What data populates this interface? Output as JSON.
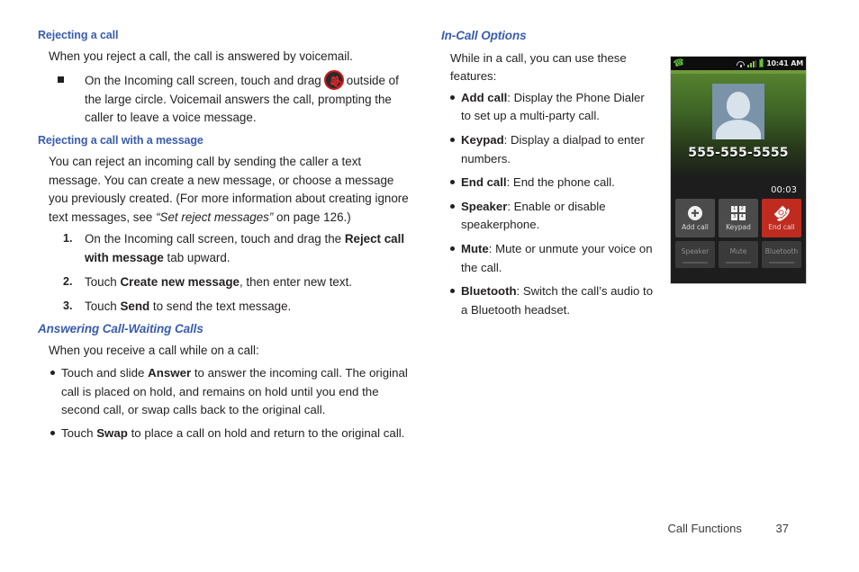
{
  "left_column": {
    "section1": {
      "heading": "Rejecting a call",
      "intro": "When you reject a call, the call is answered by voicemail.",
      "bullet_pre": "On the Incoming call screen, touch and drag",
      "bullet_post": "outside of the large circle. Voicemail answers the call, prompting the caller to leave a voice message.",
      "icon_name": "reject-call-icon"
    },
    "section2": {
      "heading": "Rejecting a call with a message",
      "intro_a": "You can reject an incoming call by sending the caller a text message. You can create a new message, or choose a message you previously created. (For more information about creating ignore text messages, see ",
      "intro_italic": "“Set reject messages”",
      "intro_b": " on page 126.)",
      "steps": [
        {
          "pre": "On the Incoming call screen, touch and drag the ",
          "bold": "Reject call with message",
          "post": " tab upward."
        },
        {
          "pre": "Touch ",
          "bold": "Create new message",
          "post": ", then enter new text."
        },
        {
          "pre": "Touch ",
          "bold": "Send",
          "post": " to send the text message."
        }
      ]
    },
    "section3": {
      "heading": "Answering Call-Waiting Calls",
      "intro": "When you receive a call while on a call:",
      "bullets": [
        {
          "pre": "Touch and slide ",
          "bold": "Answer",
          "post": " to answer the incoming call. The original call is placed on hold, and remains on hold until you end the second call, or swap calls back to the original call."
        },
        {
          "pre": "Touch ",
          "bold": "Swap",
          "post": " to place a call on hold and return to the original call."
        }
      ]
    }
  },
  "right_column": {
    "heading": "In-Call Options",
    "intro": "While in a call, you can use these features:",
    "options": [
      {
        "term": "Add call",
        "desc": ": Display the Phone Dialer to set up a multi-party call."
      },
      {
        "term": "Keypad",
        "desc": ": Display a dialpad to enter numbers."
      },
      {
        "term": "End call",
        "desc": ": End the phone call."
      },
      {
        "term": "Speaker",
        "desc": ": Enable or disable speakerphone."
      },
      {
        "term": "Mute",
        "desc": ": Mute or unmute your voice on the call."
      },
      {
        "term": "Bluetooth",
        "desc": ": Switch the call’s audio to a Bluetooth headset."
      }
    ]
  },
  "phone_screenshot": {
    "status": {
      "phone_icon": "phone-call-icon",
      "wifi_icon": "wifi-icon",
      "signal_icon": "signal-bars-icon",
      "battery_icon": "battery-icon",
      "time": "10:41 AM"
    },
    "caller_number": "555-555-5555",
    "call_timer": "00:03",
    "avatar_name": "contact-avatar",
    "buttons_row1": [
      {
        "label": "Add call",
        "icon": "plus-circle-icon"
      },
      {
        "label": "Keypad",
        "icon": "dialpad-icon"
      },
      {
        "label": "End call",
        "icon": "end-call-icon"
      }
    ],
    "buttons_row2": [
      {
        "label": "Speaker"
      },
      {
        "label": "Mute"
      },
      {
        "label": "Bluetooth"
      }
    ],
    "keypad_keys": [
      "1",
      "2",
      "3",
      "4"
    ]
  },
  "footer": {
    "chapter": "Call Functions",
    "page_number": "37"
  },
  "colors": {
    "heading_blue": "#3a5cad",
    "body_text": "#231f20",
    "end_call_red": "#c02b20",
    "accent_green": "#62c13c"
  }
}
